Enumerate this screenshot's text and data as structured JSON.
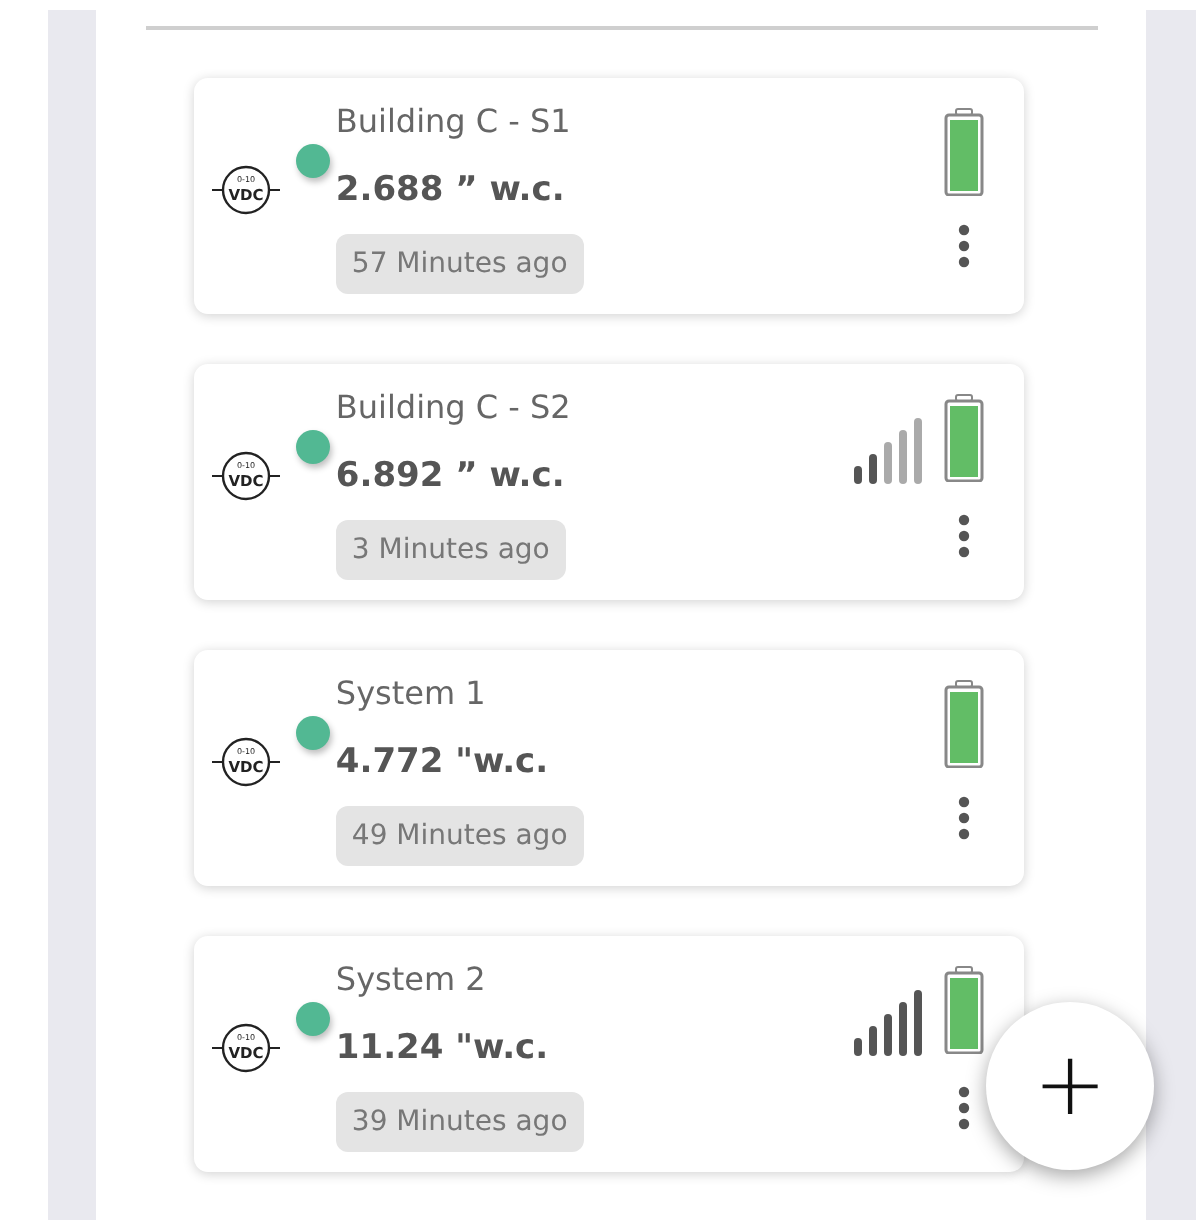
{
  "sensors": [
    {
      "name": "Building C - S1",
      "reading": "2.688 ” w.c.",
      "updated": "57 Minutes ago",
      "range_label": "0-10",
      "unit_label": "VDC",
      "color": "#52b893",
      "has_signal": false
    },
    {
      "name": "Building C - S2",
      "reading": "6.892 ” w.c.",
      "updated": "3 Minutes ago",
      "range_label": "0-10",
      "unit_label": "VDC",
      "color": "#52b893",
      "has_signal": true,
      "signal_strong": false
    },
    {
      "name": "System 1",
      "reading": "4.772 \"w.c.",
      "updated": "49 Minutes ago",
      "range_label": "0-10",
      "unit_label": "VDC",
      "color": "#52b893",
      "has_signal": false
    },
    {
      "name": "System 2",
      "reading": "11.24 \"w.c.",
      "updated": "39 Minutes ago",
      "range_label": "0-10",
      "unit_label": "VDC",
      "color": "#52b893",
      "has_signal": true,
      "signal_strong": true
    }
  ],
  "add_button": {
    "label": "+"
  }
}
